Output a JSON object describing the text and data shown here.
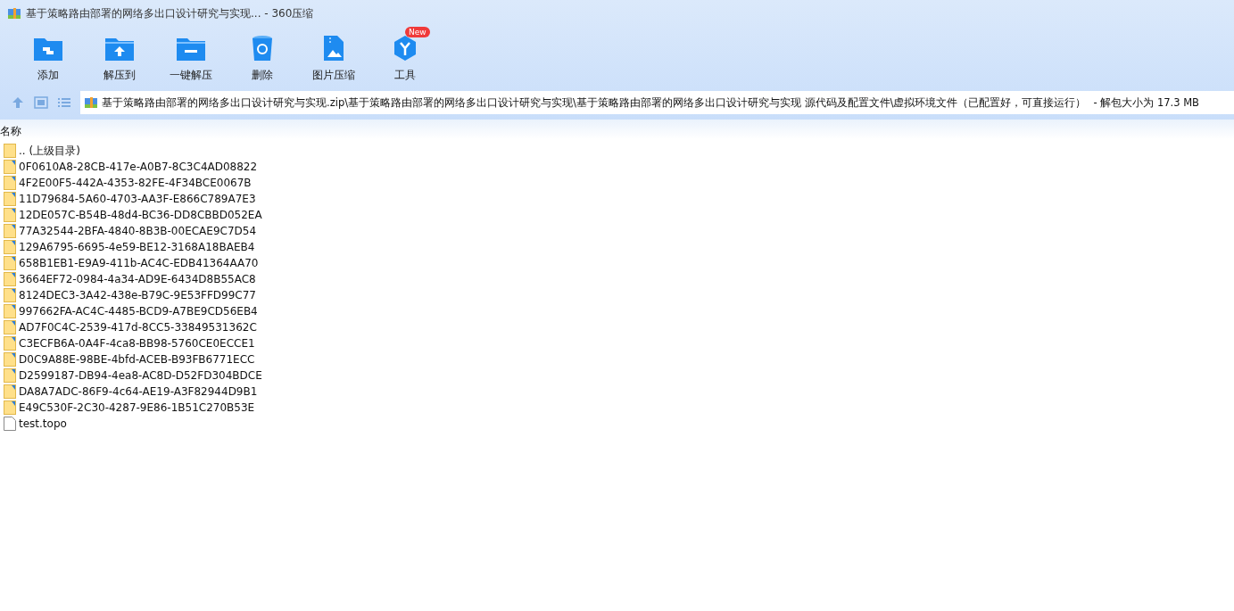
{
  "window": {
    "title": "基于策略路由部署的网络多出口设计研究与实现... - 360压缩"
  },
  "toolbar": [
    {
      "kind": "add",
      "label": "添加"
    },
    {
      "kind": "extract-to",
      "label": "解压到"
    },
    {
      "kind": "extract",
      "label": "一键解压"
    },
    {
      "kind": "delete",
      "label": "删除"
    },
    {
      "kind": "image",
      "label": "图片压缩"
    },
    {
      "kind": "tools",
      "label": "工具",
      "badge": "New"
    }
  ],
  "address_bar": {
    "path": "基于策略路由部署的网络多出口设计研究与实现.zip\\基于策略路由部署的网络多出口设计研究与实现\\基于策略路由部署的网络多出口设计研究与实现 源代码及配置文件\\虚拟环境文件（已配置好，可直接运行）",
    "info": " - 解包大小为 17.3 MB"
  },
  "table": {
    "columns": [
      "名称"
    ],
    "rows": [
      {
        "kind": "parent",
        "name": ".. (上级目录)"
      },
      {
        "kind": "folder",
        "name": "0F0610A8-28CB-417e-A0B7-8C3C4AD08822"
      },
      {
        "kind": "folder",
        "name": "4F2E00F5-442A-4353-82FE-4F34BCE0067B"
      },
      {
        "kind": "folder",
        "name": "11D79684-5A60-4703-AA3F-E866C789A7E3"
      },
      {
        "kind": "folder",
        "name": "12DE057C-B54B-48d4-BC36-DD8CBBD052EA"
      },
      {
        "kind": "folder",
        "name": "77A32544-2BFA-4840-8B3B-00ECAE9C7D54"
      },
      {
        "kind": "folder",
        "name": "129A6795-6695-4e59-BE12-3168A18BAEB4"
      },
      {
        "kind": "folder",
        "name": "658B1EB1-E9A9-411b-AC4C-EDB41364AA70"
      },
      {
        "kind": "folder",
        "name": "3664EF72-0984-4a34-AD9E-6434D8B55AC8"
      },
      {
        "kind": "folder",
        "name": "8124DEC3-3A42-438e-B79C-9E53FFD99C77"
      },
      {
        "kind": "folder",
        "name": "997662FA-AC4C-4485-BCD9-A7BE9CD56EB4"
      },
      {
        "kind": "folder",
        "name": "AD7F0C4C-2539-417d-8CC5-33849531362C"
      },
      {
        "kind": "folder",
        "name": "C3ECFB6A-0A4F-4ca8-BB98-5760CE0ECCE1"
      },
      {
        "kind": "folder",
        "name": "D0C9A88E-98BE-4bfd-ACEB-B93FB6771ECC"
      },
      {
        "kind": "folder",
        "name": "D2599187-DB94-4ea8-AC8D-D52FD304BDCE"
      },
      {
        "kind": "folder",
        "name": "DA8A7ADC-86F9-4c64-AE19-A3F82944D9B1"
      },
      {
        "kind": "folder",
        "name": "E49C530F-2C30-4287-9E86-1B51C270B53E"
      },
      {
        "kind": "file",
        "name": "test.topo"
      }
    ]
  }
}
